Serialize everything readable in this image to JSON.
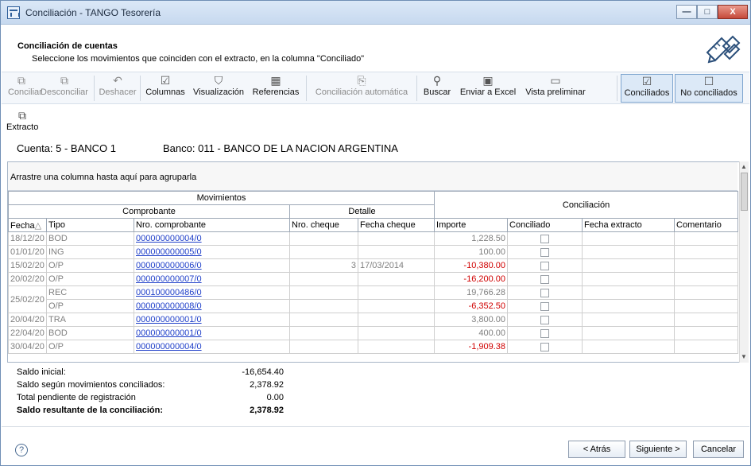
{
  "window": {
    "title": "Conciliación - TANGO Tesorería",
    "controls": {
      "min": "—",
      "max": "□",
      "close": "X"
    }
  },
  "header": {
    "title": "Conciliación de cuentas",
    "subtitle": "Seleccione los movimientos que coinciden con el extracto, en la columna \"Conciliado\""
  },
  "toolbar": {
    "items": [
      {
        "label": "Conciliar",
        "icon": "conciliar-icon",
        "glyph": "⧉"
      },
      {
        "label": "Desconciliar",
        "icon": "desconciliar-icon",
        "glyph": "⧉"
      },
      {
        "label": "Deshacer",
        "icon": "undo-icon",
        "glyph": "↶"
      },
      {
        "label": "Columnas",
        "icon": "columns-checkbox-icon",
        "glyph": "☑"
      },
      {
        "label": "Visualización",
        "icon": "filter-icon",
        "glyph": "⛉"
      },
      {
        "label": "Referencias",
        "icon": "references-icon",
        "glyph": "▦"
      },
      {
        "label": "Conciliación automática",
        "icon": "auto-reconcile-icon",
        "glyph": "⎘"
      },
      {
        "label": "Buscar",
        "icon": "binoculars-icon",
        "glyph": "⚲"
      },
      {
        "label": "Enviar a Excel",
        "icon": "excel-icon",
        "glyph": "▣"
      },
      {
        "label": "Vista preliminar",
        "icon": "monitor-icon",
        "glyph": "▭"
      },
      {
        "label": "Conciliados",
        "icon": "checked-box-icon",
        "glyph": "☑"
      },
      {
        "label": "No conciliados",
        "icon": "empty-box-icon",
        "glyph": "☐"
      }
    ],
    "extracto": {
      "label": "Extracto",
      "glyph": "⧉"
    }
  },
  "account": {
    "cuenta": "Cuenta:  5 - BANCO 1",
    "banco": "Banco: 011 - BANCO DE LA NACION ARGENTINA"
  },
  "grid": {
    "group_hint": "Arrastre una columna hasta aquí para agruparla",
    "headers": {
      "movimientos": "Movimientos",
      "conciliacion": "Conciliación",
      "comprobante": "Comprobante",
      "detalle": "Detalle",
      "fecha": "Fecha",
      "tipo": "Tipo",
      "nro_comprobante": "Nro. comprobante",
      "nro_cheque": "Nro. cheque",
      "fecha_cheque": "Fecha cheque",
      "importe": "Importe",
      "conciliado": "Conciliado",
      "fecha_extracto": "Fecha extracto",
      "comentario": "Comentario"
    },
    "rows": [
      {
        "fecha": "18/12/20",
        "tipo": "BOD",
        "nro": "000000000004/0",
        "cheque": "",
        "fecha_cheque": "",
        "importe": "1,228.50",
        "neg": false
      },
      {
        "fecha": "01/01/20",
        "tipo": "ING",
        "nro": "000000000005/0",
        "cheque": "",
        "fecha_cheque": "",
        "importe": "100.00",
        "neg": false
      },
      {
        "fecha": "15/02/20",
        "tipo": "O/P",
        "nro": "000000000006/0",
        "cheque": "3",
        "fecha_cheque": "17/03/2014",
        "importe": "-10,380.00",
        "neg": true
      },
      {
        "fecha": "20/02/20",
        "tipo": "O/P",
        "nro": "000000000007/0",
        "cheque": "",
        "fecha_cheque": "",
        "importe": "-16,200.00",
        "neg": true
      },
      {
        "fecha": "25/02/20",
        "tipo": "REC",
        "nro": "000100000486/0",
        "cheque": "",
        "fecha_cheque": "",
        "importe": "19,766.28",
        "neg": false
      },
      {
        "fecha": "",
        "tipo": "O/P",
        "nro": "000000000008/0",
        "cheque": "",
        "fecha_cheque": "",
        "importe": "-6,352.50",
        "neg": true
      },
      {
        "fecha": "20/04/20",
        "tipo": "TRA",
        "nro": "000000000001/0",
        "cheque": "",
        "fecha_cheque": "",
        "importe": "3,800.00",
        "neg": false
      },
      {
        "fecha": "22/04/20",
        "tipo": "BOD",
        "nro": "000000000001/0",
        "cheque": "",
        "fecha_cheque": "",
        "importe": "400.00",
        "neg": false
      },
      {
        "fecha": "30/04/20",
        "tipo": "O/P",
        "nro": "000000000004/0",
        "cheque": "",
        "fecha_cheque": "",
        "importe": "-1,909.38",
        "neg": true
      }
    ]
  },
  "summary": {
    "saldo_inicial_label": "Saldo inicial:",
    "saldo_inicial": "-16,654.40",
    "saldo_conciliados_label": "Saldo según movimientos conciliados:",
    "saldo_conciliados": "2,378.92",
    "pendiente_label": "Total pendiente de registración",
    "pendiente": "0.00",
    "resultante_label": "Saldo resultante de la conciliación:",
    "resultante": "2,378.92"
  },
  "footer": {
    "help_glyph": "?",
    "atras": "< Atrás",
    "siguiente": "Siguiente >",
    "cancelar": "Cancelar"
  },
  "colors": {
    "negative": "#d00000",
    "link": "#1f3fc9",
    "pressed": "#dce9f7"
  }
}
